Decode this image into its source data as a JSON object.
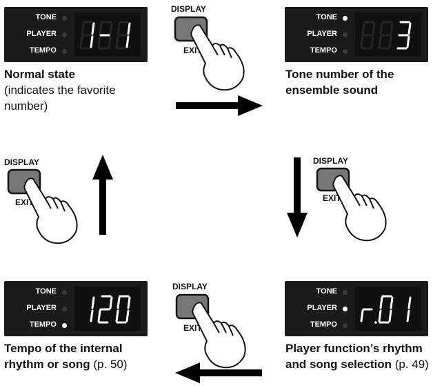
{
  "button": {
    "top_label": "DISPLAY",
    "bottom_label": "EXIT"
  },
  "indicators": [
    "TONE",
    "PLAYER",
    "TEMPO"
  ],
  "panels": {
    "normal": {
      "display": "1-1",
      "active": "none"
    },
    "tone": {
      "display": "3",
      "active": "TONE"
    },
    "tempo": {
      "display": "120",
      "active": "TEMPO"
    },
    "player": {
      "display": "r.01",
      "active": "PLAYER"
    }
  },
  "captions": {
    "normal_title": "Normal state",
    "normal_note": " (indicates the favorite number)",
    "tone_title": "Tone number of the ensemble sound",
    "tempo_title": "Tempo of the internal rhythm or song",
    "tempo_ref": " (p. 50)",
    "player_title": "Player function’s rhythm and song selection",
    "player_ref": " (p. 49)"
  },
  "colors": {
    "panel_bg": "#1b1b1b",
    "segment_on": "#ffffff",
    "segment_off": "#262626",
    "button_fill": "#777777",
    "arrow": "#000000"
  }
}
